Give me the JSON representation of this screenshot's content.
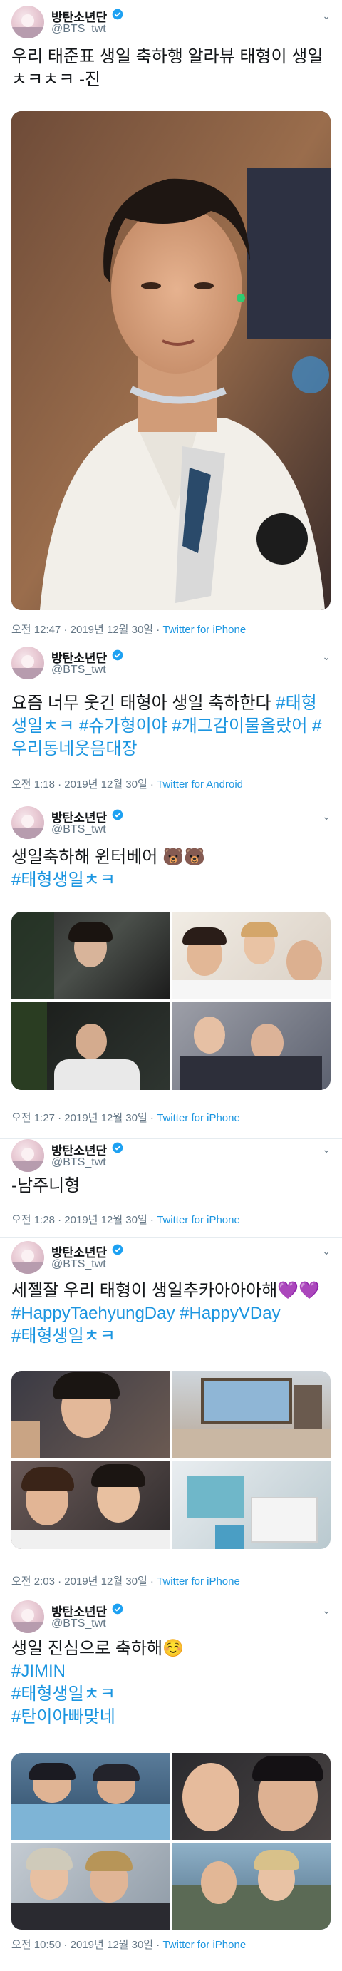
{
  "tweets": [
    {
      "name": "방탄소년단",
      "handle": "@BTS_twt",
      "text": "우리 태준표 생일 축하행 알라뷰 태형이 생일 ㅊㅋㅊㅋ -진",
      "time": "오전 12:47 · 2019년 12월 30일 · ",
      "app": "Twitter for iPhone"
    },
    {
      "name": "방탄소년단",
      "handle": "@BTS_twt",
      "text_plain": "요즘 너무 웃긴 태형아 생일 축하한다 ",
      "hashtags": [
        "#태형생일ㅊㅋ",
        "#슈가형이야",
        "#개그감이물올랐어",
        "#우리동네웃음대장"
      ],
      "time": "오전 1:18 · 2019년 12월 30일 · ",
      "app": "Twitter for Android"
    },
    {
      "name": "방탄소년단",
      "handle": "@BTS_twt",
      "text_plain": "생일축하해 윈터베어 🐻🐻",
      "hashtags": [
        "#태형생일ㅊㅋ"
      ],
      "time": "오전 1:27 · 2019년 12월 30일 · ",
      "app": "Twitter for iPhone"
    },
    {
      "name": "방탄소년단",
      "handle": "@BTS_twt",
      "text": "-남주니형",
      "time": "오전 1:28 · 2019년 12월 30일 · ",
      "app": "Twitter for iPhone"
    },
    {
      "name": "방탄소년단",
      "handle": "@BTS_twt",
      "text_plain": "세젤잘 우리 태형이 생일추카아아아해💜💜",
      "hashtags": [
        "#HappyTaehyungDay",
        "#HappyVDay",
        "#태형생일ㅊㅋ"
      ],
      "time": "오전 2:03 · 2019년 12월 30일 · ",
      "app": "Twitter for iPhone"
    },
    {
      "name": "방탄소년단",
      "handle": "@BTS_twt",
      "text_plain": "생일 진심으로 축하해☺️",
      "hashtags": [
        "#JIMIN",
        "#태형생일ㅊㅋ",
        "#탄이아빠맞네"
      ],
      "time": "오전 10:50 · 2019년 12월 30일 · ",
      "app": "Twitter for iPhone"
    }
  ],
  "icons": {
    "verified": "verified-badge-icon",
    "chevron": "chevron-down-icon"
  },
  "colors": {
    "link": "#1b95e0",
    "secondary": "#657786",
    "verified": "#1da1f2",
    "divider": "#e6ecf0"
  }
}
